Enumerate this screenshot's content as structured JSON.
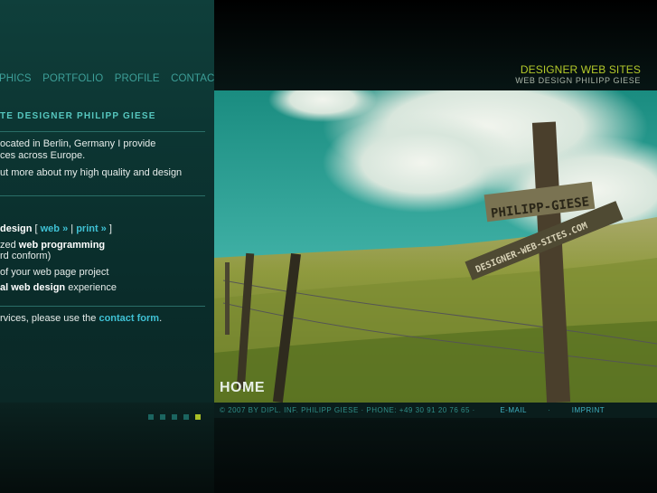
{
  "nav": {
    "items": [
      "PHICS",
      "PORTFOLIO",
      "PROFILE",
      "CONTACT"
    ]
  },
  "header": {
    "title": "DESIGNER WEB SITES",
    "subtitle": "WEB DESIGN PHILIPP GIESE"
  },
  "intro": {
    "heading": "TE DESIGNER PHILIPP GIESE",
    "line1": "ocated in Berlin, Germany I provide",
    "line2": "ces across Europe.",
    "line3": "ut more about my high quality and design"
  },
  "services": {
    "design_bold": "design",
    "bracket_open": " [ ",
    "web_link": "web »",
    "separator": " | ",
    "print_link": "print »",
    "bracket_close": " ]",
    "prog_prefix": "zed ",
    "prog_bold": "web programming",
    "prog_sub": "rd conform)",
    "project_line": "of your web page project",
    "exp_bold": "al web design",
    "exp_rest": " experience"
  },
  "contact_line": {
    "prefix": "rvices, please use the ",
    "link": "contact form",
    "suffix": "."
  },
  "photo": {
    "sign_top": "PHILIPP-GIESE",
    "sign_bottom": "DESIGNER-WEB-SITES.COM",
    "page_label": "HOME"
  },
  "footer": {
    "copyright": "© 2007 BY DIPL. INF. PHILIPP  GIESE  ·  PHONE:  +49  30  91  20  76  65      ·",
    "email": "E-MAIL",
    "dot_sep": "·",
    "imprint": "IMPRINT"
  },
  "colors": {
    "accent_lime": "#b4c92a",
    "teal_text": "#3d9f98",
    "link_cyan": "#3fc1d4"
  }
}
